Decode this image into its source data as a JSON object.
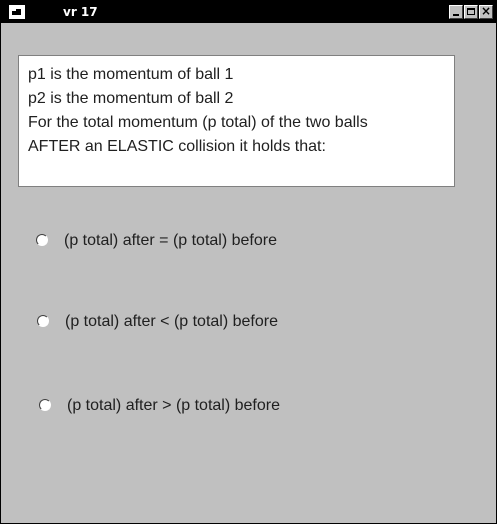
{
  "window": {
    "title": "vr 17",
    "controls": {
      "minimize_icon": "minimize-icon",
      "maximize_icon": "maximize-icon",
      "close_glyph": "×"
    }
  },
  "question": {
    "lines": [
      "p1 is the momentum of ball 1",
      "p2 is the momentum of ball 2",
      "For the total momentum (p total) of the two balls",
      "AFTER an ELASTIC collision it holds that:"
    ]
  },
  "options": [
    {
      "label": "(p total) after = (p total) before",
      "selected": false
    },
    {
      "label": "(p total) after < (p total) before",
      "selected": false
    },
    {
      "label": "(p total) after > (p total) before",
      "selected": false
    }
  ],
  "colors": {
    "titlebar": "#000000",
    "window_bg": "#c0c0c0",
    "panel_bg": "#ffffff",
    "text": "#202020"
  }
}
